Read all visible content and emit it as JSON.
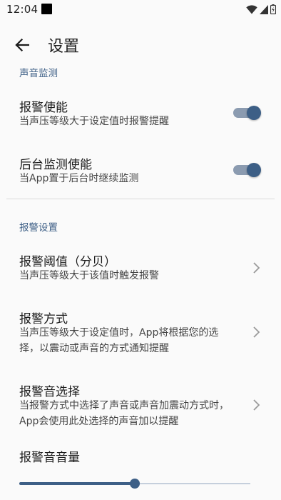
{
  "status_bar": {
    "time": "12:04",
    "icons": [
      "notification-square-icon",
      "wifi-icon",
      "cellular-signal-icon",
      "battery-icon"
    ]
  },
  "app_bar": {
    "back_icon": "arrow-left-icon",
    "title": "设置"
  },
  "colors": {
    "accent": "#3d5f86",
    "switch_track": "#8b9bb0",
    "background": "#fafafa"
  },
  "sections": {
    "sound_monitoring": {
      "header": "声音监测",
      "alarm_enable": {
        "title": "报警使能",
        "summary": "当声压等级大于设定值时报警提醒",
        "on": true
      },
      "background_monitor": {
        "title": "后台监测使能",
        "summary": "当App置于后台时继续监测",
        "on": true
      }
    },
    "alarm_settings": {
      "header": "报警设置",
      "threshold": {
        "title": "报警阈值（分贝）",
        "summary": "当声压等级大于该值时触发报警"
      },
      "mode": {
        "title": "报警方式",
        "summary": "当声压等级大于设定值时，App将根据您的选择，以震动或声音的方式通知提醒"
      },
      "sound_select": {
        "title": "报警音选择",
        "summary": "当报警方式中选择了声音或声音加震动方式时，App会使用此处选择的声音加以提醒"
      },
      "volume": {
        "title": "报警音音量",
        "level": 0.5
      }
    }
  }
}
